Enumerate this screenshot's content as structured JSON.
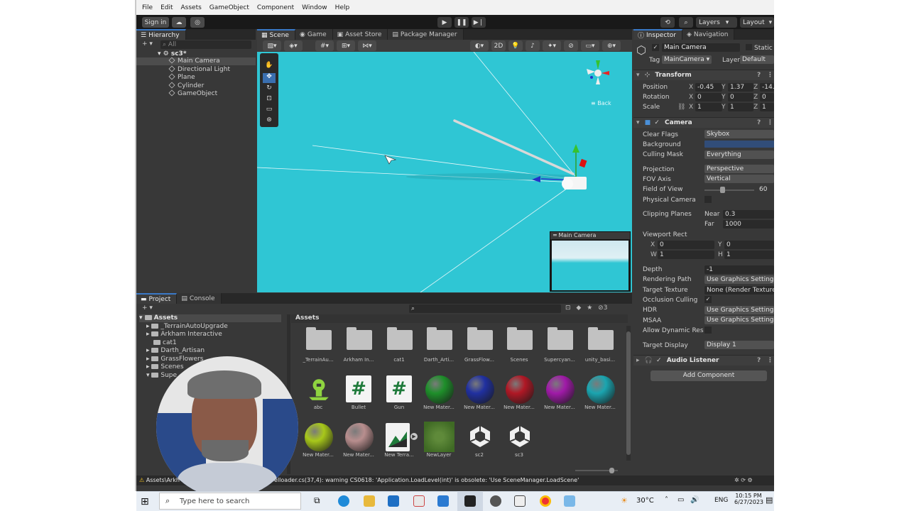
{
  "menubar": {
    "items": [
      "File",
      "Edit",
      "Assets",
      "GameObject",
      "Component",
      "Window",
      "Help"
    ]
  },
  "toolbar": {
    "sign_in": "Sign in",
    "layers": "Layers",
    "layout": "Layout"
  },
  "hierarchy": {
    "tab": "Hierarchy",
    "search_placeholder": "All",
    "scene": "sc3*",
    "items": [
      "Main Camera",
      "Directional Light",
      "Plane",
      "Cylinder",
      "GameObject"
    ]
  },
  "scene_tabs": [
    "Scene",
    "Game",
    "Asset Store",
    "Package Manager"
  ],
  "scene_view": {
    "mode_2d": "2D",
    "gizmo_label": "Back",
    "preview_title": "Main Camera"
  },
  "inspector": {
    "tabs": [
      "Inspector",
      "Navigation"
    ],
    "object_name": "Main Camera",
    "static_label": "Static",
    "tag_label": "Tag",
    "tag_value": "MainCamera",
    "layer_label": "Layer",
    "layer_value": "Default",
    "transform": {
      "title": "Transform",
      "position_label": "Position",
      "rotation_label": "Rotation",
      "scale_label": "Scale",
      "pos": [
        "-0.45",
        "1.37",
        "-14."
      ],
      "rot": [
        "0",
        "0",
        "0"
      ],
      "scale": [
        "1",
        "1",
        "1"
      ],
      "axes": [
        "X",
        "Y",
        "Z"
      ]
    },
    "camera": {
      "title": "Camera",
      "clear_flags_label": "Clear Flags",
      "clear_flags": "Skybox",
      "background_label": "Background",
      "culling_label": "Culling Mask",
      "culling": "Everything",
      "projection_label": "Projection",
      "projection": "Perspective",
      "fov_axis_label": "FOV Axis",
      "fov_axis": "Vertical",
      "fov_label": "Field of View",
      "fov": "60",
      "physical_label": "Physical Camera",
      "clipping_label": "Clipping Planes",
      "near_label": "Near",
      "near": "0.3",
      "far_label": "Far",
      "far": "1000",
      "viewport_label": "Viewport Rect",
      "vx_label": "X",
      "vx": "0",
      "vy_label": "Y",
      "vy": "0",
      "vw_label": "W",
      "vw": "1",
      "vh_label": "H",
      "vh": "1",
      "depth_label": "Depth",
      "depth": "-1",
      "rendering_label": "Rendering Path",
      "rendering": "Use Graphics Settings",
      "target_tex_label": "Target Texture",
      "target_tex": "None (Render Texture)",
      "occlusion_label": "Occlusion Culling",
      "hdr_label": "HDR",
      "hdr": "Use Graphics Settings",
      "msaa_label": "MSAA",
      "msaa": "Use Graphics Settings",
      "dynres_label": "Allow Dynamic Resol",
      "target_display_label": "Target Display",
      "target_display": "Display 1"
    },
    "audio_listener": "Audio Listener",
    "add_component": "Add Component"
  },
  "project": {
    "tabs": [
      "Project",
      "Console"
    ],
    "root": "Assets",
    "tree": [
      "_TerrainAutoUpgrade",
      "Arkham Interactive",
      "cat1",
      "Darth_Artisan",
      "GrassFlowers",
      "Scenes",
      "Supe"
    ],
    "breadcrumb": "Assets",
    "count": "3",
    "assets_row1": [
      "_TerrainAu...",
      "Arkham In...",
      "cat1",
      "Darth_Arti...",
      "GrassFlow...",
      "Scenes",
      "Supercyan...",
      "unity_basi..."
    ],
    "assets_row2": [
      "abc",
      "Bullet",
      "Gun",
      "New Mater...",
      "New Mater...",
      "New Mater...",
      "New Mater...",
      "New Mater..."
    ],
    "assets_row3": [
      "New Mater...",
      "New Mater...",
      "New Terra...",
      "NewLayer",
      "sc2",
      "sc3"
    ],
    "sphere_colors_row2": [
      "#1e8f2a",
      "#2030a0",
      "#b01825",
      "#a01aa8",
      "#1aa5b0"
    ],
    "sphere_colors_row3": [
      "#a8c81a",
      "#b88e8e"
    ]
  },
  "statusbar": {
    "text": "Assets\\Arkh",
    "text2": "ripts\\Levelloader.cs(37,4): warning CS0618: 'Application.LoadLevel(int)' is obsolete: 'Use SceneManager.LoadScene'"
  },
  "taskbar": {
    "search_placeholder": "Type here to search",
    "weather": "30°C",
    "lang": "ENG",
    "time": "10:15 PM",
    "date": "6/27/2023"
  }
}
